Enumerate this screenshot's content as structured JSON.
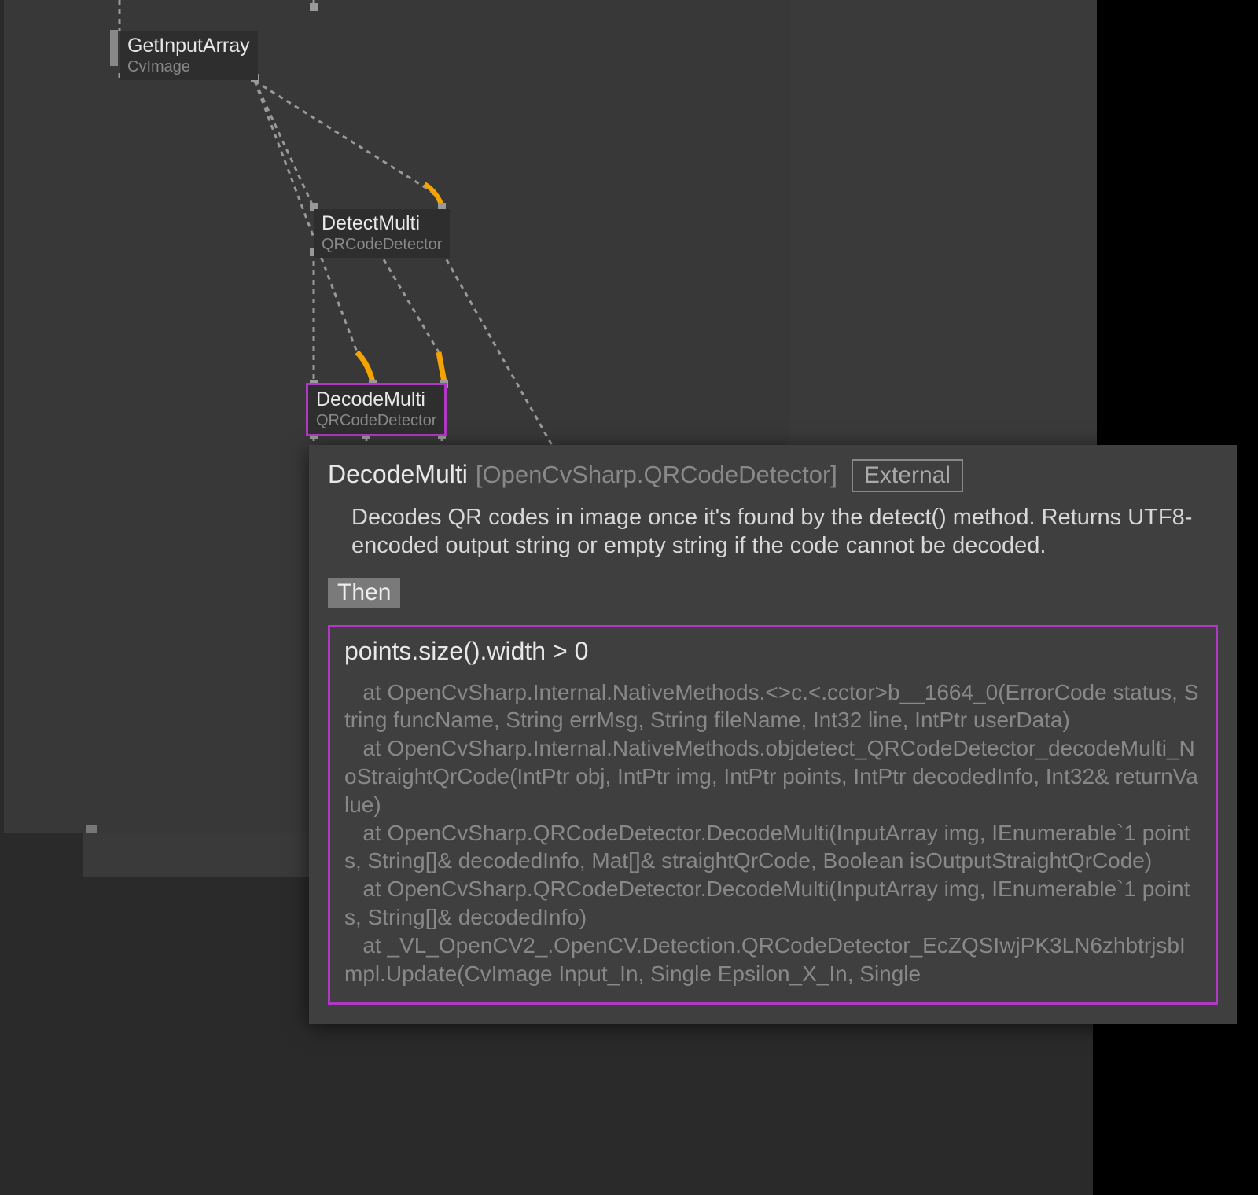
{
  "nodes": {
    "getInputArray": {
      "title": "GetInputArray",
      "sub": "CvImage"
    },
    "detectMulti": {
      "title": "DetectMulti",
      "sub": "QRCodeDetector"
    },
    "decodeMulti": {
      "title": "DecodeMulti",
      "sub": "QRCodeDetector"
    }
  },
  "tooltip": {
    "name": "DecodeMulti",
    "origin": "[OpenCvSharp.QRCodeDetector]",
    "badge": "External",
    "description": "Decodes QR codes in image once it's found by the detect() method. Returns UTF8-encoded output string or empty string if the code cannot be decoded.",
    "then_label": "Then",
    "error_title": "points.size().width > 0",
    "error_stack": "   at OpenCvSharp.Internal.NativeMethods.<>c.<.cctor>b__1664_0(ErrorCode status, String funcName, String errMsg, String fileName, Int32 line, IntPtr userData)\n   at OpenCvSharp.Internal.NativeMethods.objdetect_QRCodeDetector_decodeMulti_NoStraightQrCode(IntPtr obj, IntPtr img, IntPtr points, IntPtr decodedInfo, Int32& returnValue)\n   at OpenCvSharp.QRCodeDetector.DecodeMulti(InputArray img, IEnumerable`1 points, String[]& decodedInfo, Mat[]& straightQrCode, Boolean isOutputStraightQrCode)\n   at OpenCvSharp.QRCodeDetector.DecodeMulti(InputArray img, IEnumerable`1 points, String[]& decodedInfo)\n   at _VL_OpenCV2_.OpenCV.Detection.QRCodeDetector_EcZQSIwjPK3LN6zhbtrjsbImpl.Update(CvImage Input_In, Single Epsilon_X_In, Single"
  }
}
